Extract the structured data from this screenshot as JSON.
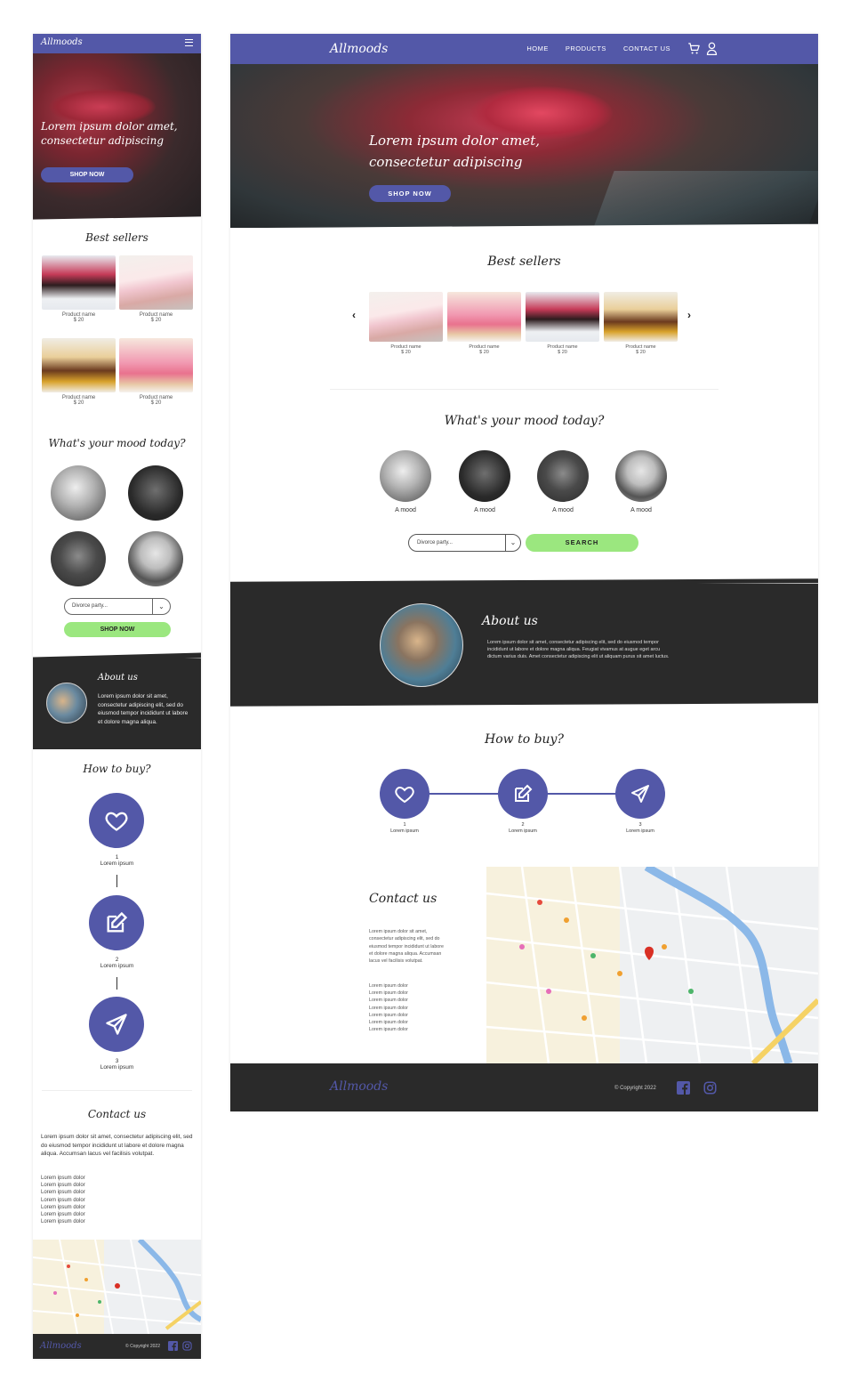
{
  "brand": {
    "logo_text": "Allmoods",
    "primary_color": "#5358a8",
    "accent_color": "#9be77f",
    "dark_color": "#2a2a2a"
  },
  "nav": {
    "items": [
      "HOME",
      "PRODUCTS",
      "CONTACT US"
    ],
    "icons": [
      "cart-icon",
      "user-icon",
      "hamburger-menu-icon"
    ]
  },
  "hero": {
    "title": "Lorem ipsum dolor amet, consectetur adipiscing",
    "mobile_title": "Lorem ipsum dolor amet, consectetur adipiscing",
    "button": "SHOP NOW"
  },
  "bestsellers": {
    "title": "Best sellers",
    "products": [
      {
        "name": "Product name",
        "price": "$ 20"
      },
      {
        "name": "Product name",
        "price": "$ 20"
      },
      {
        "name": "Product name",
        "price": "$ 20"
      },
      {
        "name": "Product name",
        "price": "$ 20"
      }
    ],
    "mobile_products": [
      {
        "name": "Product name",
        "price": "$ 20"
      },
      {
        "name": "Product name",
        "price": "$ 20"
      },
      {
        "name": "Product name",
        "price": "$ 20"
      },
      {
        "name": "Product name",
        "price": "$ 20"
      }
    ]
  },
  "mood": {
    "title": "What's your mood today?",
    "items": [
      "A mood",
      "A mood",
      "A mood",
      "A mood"
    ],
    "select_value": "Divorce party...",
    "search_button": "SEARCH",
    "mobile_button": "SHOP NOW"
  },
  "about": {
    "title": "About us",
    "desktop_text": "Lorem ipsum dolor sit amet, consectetur adipiscing elit, sed do eiusmod tempor incididunt ut labore et dolore magna aliqua. Feugiat vivamus at augue eget arcu dictum varius duis. Amet consectetur adipiscing elit ut aliquam purus sit amet luctus.",
    "mobile_text": "Lorem ipsum dolor sit amet, consectetur adipiscing elit, sed do eiusmod tempor incididunt ut labore et dolore magna aliqua."
  },
  "howto": {
    "title": "How to buy?",
    "steps": [
      {
        "num": "1",
        "label": "Lorem ipsum",
        "icon": "heart-icon"
      },
      {
        "num": "2",
        "label": "Lorem ipsum",
        "icon": "edit-icon"
      },
      {
        "num": "3",
        "label": "Lorem ipsum",
        "icon": "send-icon"
      }
    ]
  },
  "contact": {
    "title": "Contact us",
    "desktop_text": "Lorem ipsum dolor sit amet, consectetur adipiscing elit, sed do eiusmod tempor incididunt ut labore et dolore magna aliqua. Accumsan lacus vel facilisis volutpat.",
    "mobile_text": "Lorem ipsum dolor sit amet, consectetur adipiscing elit, sed do eiusmod tempor incididunt ut labore et dolore magna aliqua. Accumsan lacus vel facilisis volutpat.",
    "list": [
      "Lorem ipsum dolor",
      "Lorem ipsum dolor",
      "Lorem ipsum dolor",
      "Lorem ipsum dolor",
      "Lorem ipsum dolor",
      "Lorem ipsum dolor",
      "Lorem ipsum dolor"
    ]
  },
  "footer": {
    "copyright": "© Copyright 2022",
    "social": [
      "facebook-icon",
      "instagram-icon"
    ]
  }
}
